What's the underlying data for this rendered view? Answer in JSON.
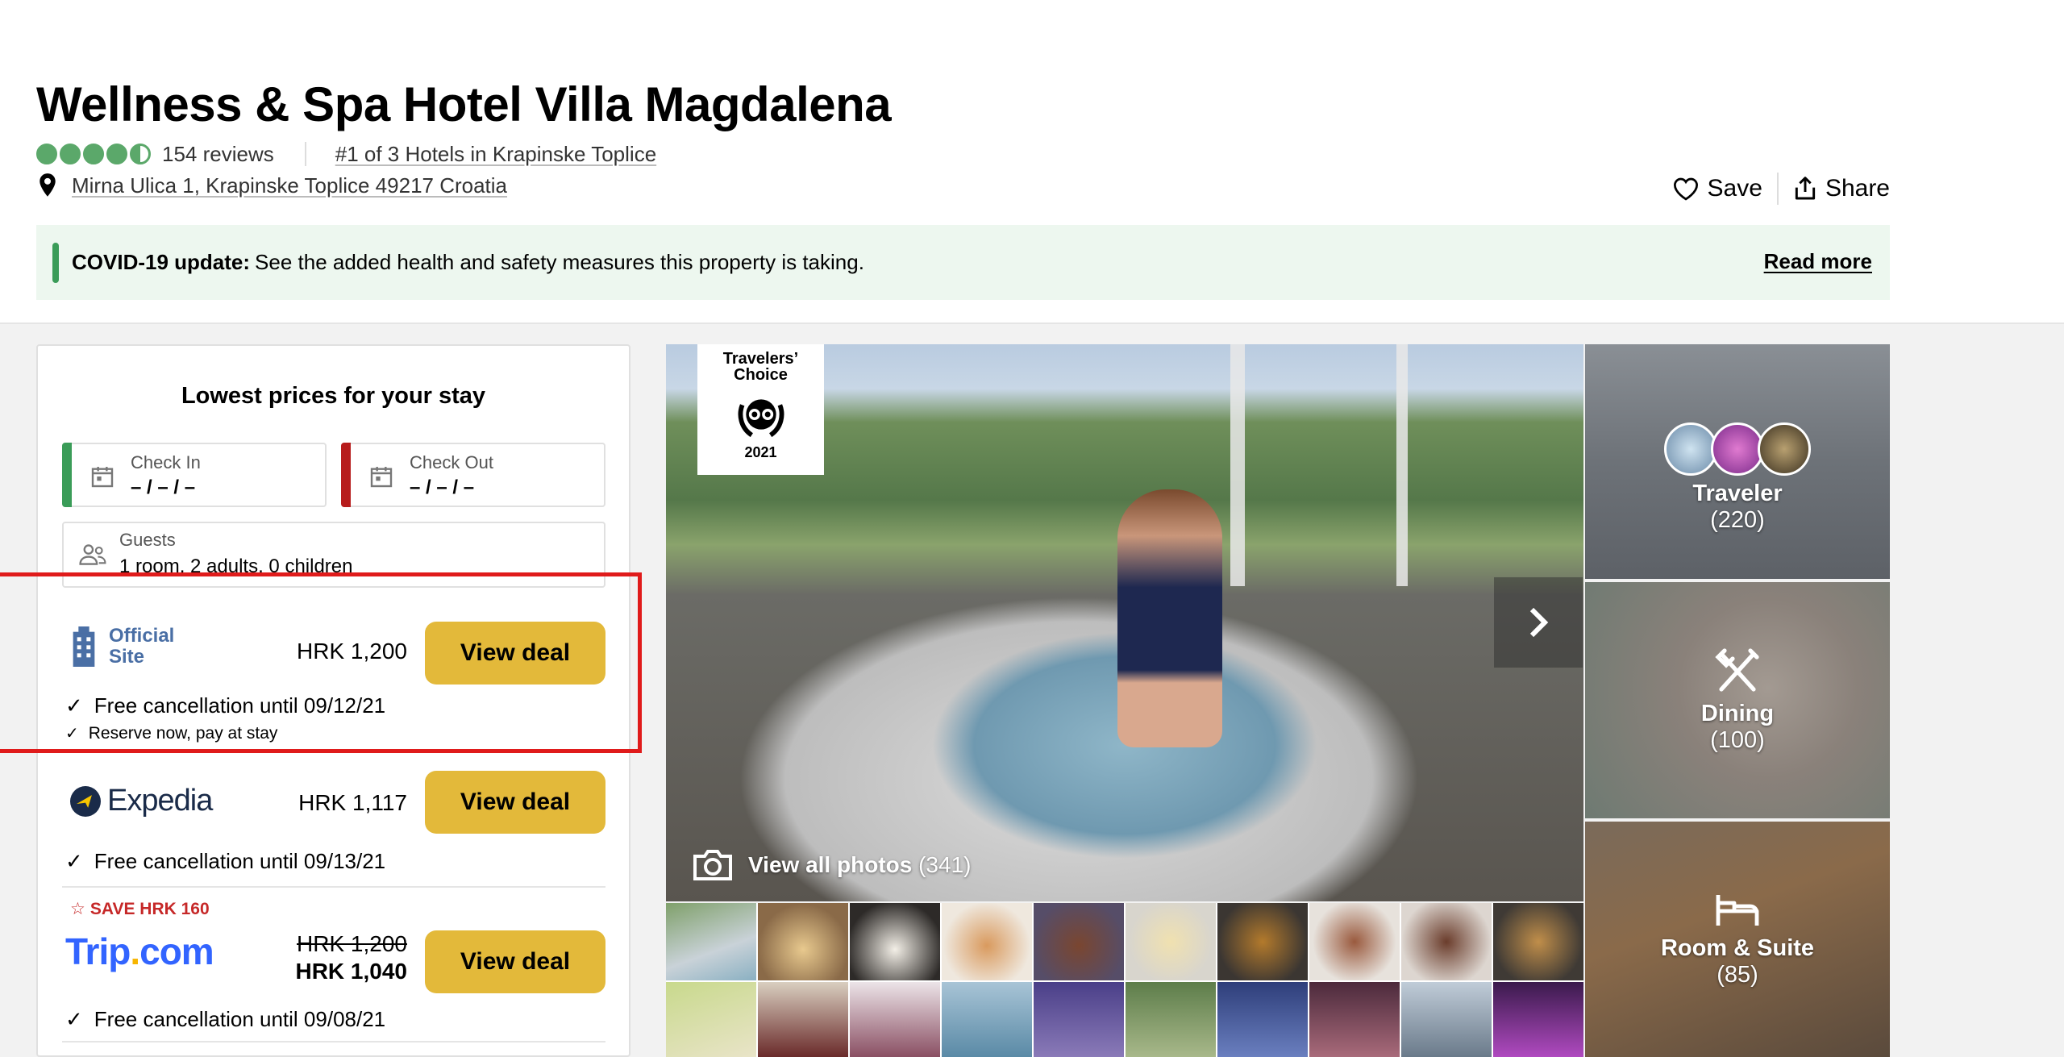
{
  "header": {
    "title": "Wellness & Spa Hotel Villa Magdalena",
    "reviews": "154 reviews",
    "rank": "#1 of 3 Hotels in Krapinske Toplice",
    "address": "Mirna Ulica 1, Krapinske Toplice 49217 Croatia",
    "save_label": "Save",
    "share_label": "Share",
    "rating_bubbles": 4.5
  },
  "covid": {
    "label": "COVID-19 update:",
    "text": "See the added health and safety measures this property is taking.",
    "read_more": "Read more"
  },
  "booking": {
    "title": "Lowest prices for your stay",
    "check_in_label": "Check In",
    "check_in_value": "– / – / –",
    "check_out_label": "Check Out",
    "check_out_value": "– / – / –",
    "guests_label": "Guests",
    "guests_value": "1 room, 2 adults, 0 children",
    "offers": [
      {
        "provider": "Official Site",
        "provider_line1": "Official",
        "provider_line2": "Site",
        "price": "HRK 1,200",
        "button": "View deal",
        "cancellation": "Free cancellation until 09/12/21",
        "extra": "Reserve now, pay at stay"
      },
      {
        "provider": "Expedia",
        "price": "HRK 1,117",
        "button": "View deal",
        "cancellation": "Free cancellation until 09/13/21"
      },
      {
        "provider_name": "Trip",
        "provider_tld": "com",
        "save_tag": "SAVE HRK 160",
        "old_price": "HRK 1,200",
        "price": "HRK 1,040",
        "button": "View deal",
        "cancellation": "Free cancellation until 09/08/21"
      }
    ]
  },
  "gallery": {
    "badge_line1": "Travelers’",
    "badge_line2": "Choice",
    "badge_year": "2021",
    "view_all_label": "View all photos",
    "view_all_count": "(341)",
    "tiles": [
      {
        "name": "Traveler",
        "count": "(220)"
      },
      {
        "name": "Dining",
        "count": "(100)"
      },
      {
        "name": "Room & Suite",
        "count": "(85)"
      }
    ]
  },
  "colors": {
    "rating_green": "#5ba86a",
    "deal_button": "#e3b93a",
    "covid_bg": "#edf7ef",
    "highlight_red": "#e01b1b",
    "trip_blue": "#3264ff",
    "expedia_navy": "#1a2b49"
  }
}
